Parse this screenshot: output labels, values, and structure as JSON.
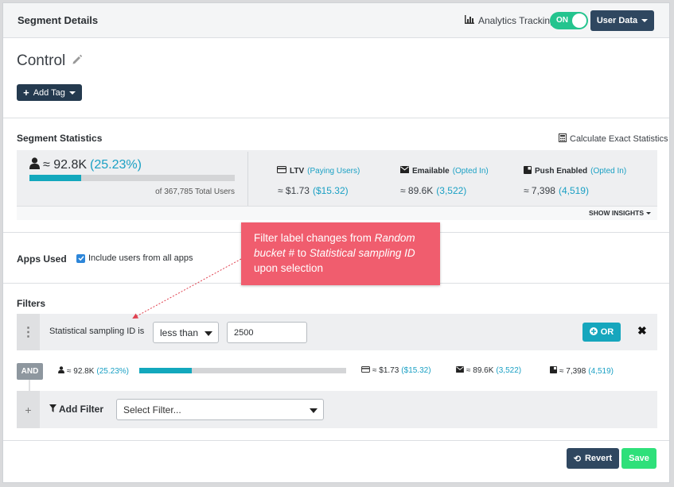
{
  "header": {
    "title": "Segment Details",
    "tracking_label": "Analytics Tracking",
    "toggle_label": "ON",
    "user_data_label": "User Data"
  },
  "segment": {
    "name": "Control",
    "add_tag_label": "Add Tag"
  },
  "statistics": {
    "title": "Segment Statistics",
    "calculate_label": "Calculate Exact Statistics",
    "users_value": "≈ 92.8K",
    "users_pct": "(25.23%)",
    "users_fraction": 0.2523,
    "total_label": "of 367,785 Total Users",
    "ltv": {
      "label": "LTV",
      "qualifier": "(Paying Users)",
      "value": "≈ $1.73",
      "value_sub": "($15.32)"
    },
    "emailable": {
      "label": "Emailable",
      "qualifier": "(Opted In)",
      "value": "≈ 89.6K",
      "value_sub": "(3,522)"
    },
    "push": {
      "label": "Push Enabled",
      "qualifier": "(Opted In)",
      "value": "≈ 7,398",
      "value_sub": "(4,519)"
    },
    "show_insights_label": "SHOW INSIGHTS"
  },
  "apps": {
    "title": "Apps Used",
    "include_label": "Include users from all apps",
    "include_checked": true
  },
  "filters": {
    "title": "Filters",
    "filter_label": "Statistical sampling ID is",
    "operator": "less than",
    "value": "2500",
    "or_label": "OR",
    "and_label": "AND",
    "row_stats": {
      "users_value": "≈ 92.8K",
      "users_pct": "(25.23%)",
      "users_fraction": 0.2523,
      "ltv_value": "≈ $1.73",
      "ltv_sub": "($15.32)",
      "email_value": "≈ 89.6K",
      "email_sub": "(3,522)",
      "push_value": "≈ 7,398",
      "push_sub": "(4,519)"
    },
    "add_filter_label": "Add Filter",
    "select_placeholder": "Select Filter..."
  },
  "callout": {
    "line_start": "Filter label changes from ",
    "from_italic": "Random bucket #",
    "to_text": " to ",
    "to_italic": "Statistical sampling ID",
    "line_end": " upon selection"
  },
  "footer": {
    "revert_label": "Revert",
    "save_label": "Save"
  },
  "colors": {
    "accent": "#13a8bd",
    "toggle_on": "#24c48e",
    "dark_button": "#2f4760",
    "save": "#2ee07a",
    "callout": "#f05d6e"
  }
}
